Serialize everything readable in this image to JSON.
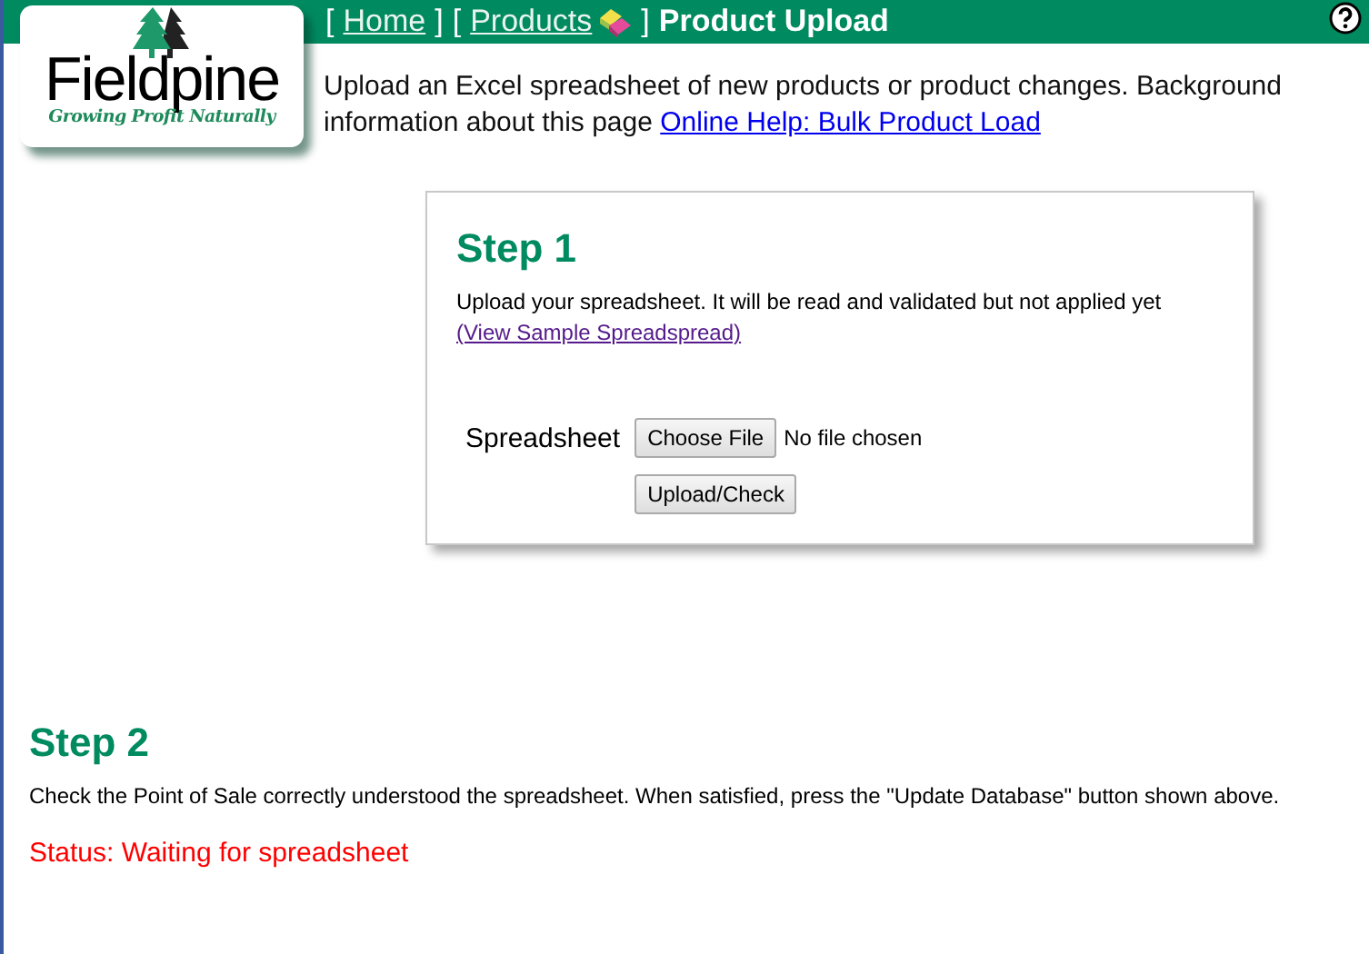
{
  "logo": {
    "name": "Fieldpine",
    "tagline": "Growing Profit Naturally"
  },
  "breadcrumb": [
    {
      "kind": "bracket",
      "text": "["
    },
    {
      "kind": "link",
      "text": "Home"
    },
    {
      "kind": "bracket",
      "text": "]"
    },
    {
      "kind": "bracket",
      "text": "["
    },
    {
      "kind": "link",
      "text": "Products",
      "icon": true
    },
    {
      "kind": "bracket",
      "text": "]"
    },
    {
      "kind": "current",
      "text": "Product Upload"
    }
  ],
  "intro": {
    "text": "Upload an Excel spreadsheet of new products or product changes. Background information about this page",
    "link": "Online Help: Bulk Product Load"
  },
  "step1": {
    "title": "Step 1",
    "text": "Upload your spreadsheet. It will be read and validated but not applied yet",
    "link": "(View Sample Spreadspread)",
    "field_label": "Spreadsheet",
    "choose_button": "Choose File",
    "file_status": "No file chosen",
    "submit_button": "Upload/Check"
  },
  "step2": {
    "title": "Step 2",
    "text": "Check the Point of Sale correctly understood the spreadsheet. When satisfied, press the \"Update Database\" button shown above.",
    "status": "Status: Waiting for spreadsheet"
  }
}
